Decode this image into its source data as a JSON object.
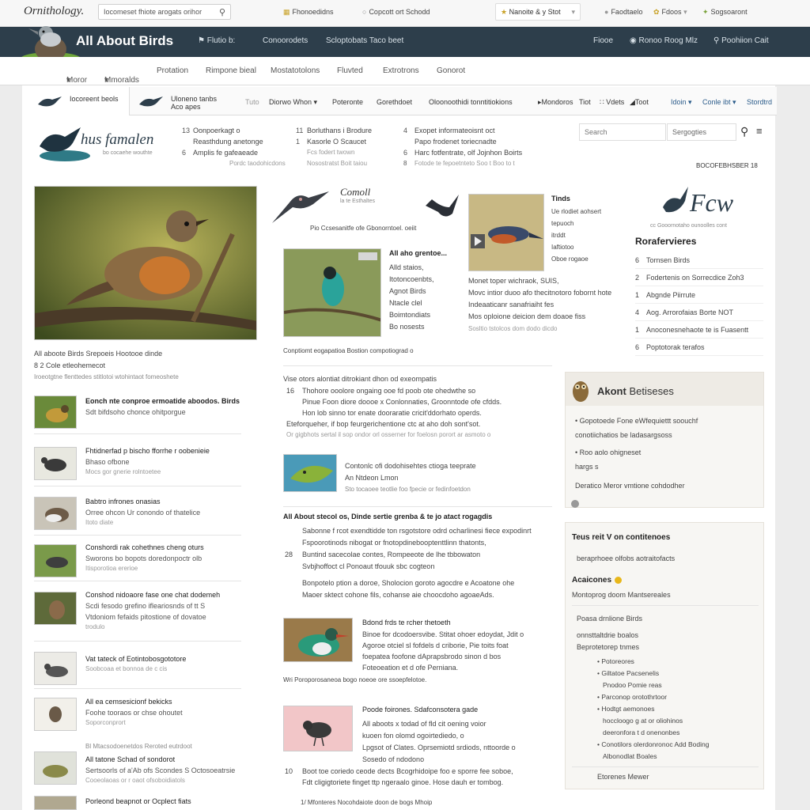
{
  "topbar": {
    "logo": "Ornithology.",
    "search_value": "Iocomeset fhiote arogats orihor",
    "links": [
      "Fhonoedidns",
      "Copcott ort Schodd"
    ],
    "dropdown": "Nanoite & y Stot",
    "right_links": [
      "Faodtaelo",
      "Fdoos",
      "Sogsoaront"
    ]
  },
  "nav": {
    "brand": "All About Birds",
    "links": [
      "Flutio b:",
      "Conoorodets",
      "Scloptobats Taco beet"
    ],
    "right": [
      "Fiooe",
      "Ronoo Roog Mlz",
      "Poohiion Cait"
    ]
  },
  "subnav": [
    "Moror",
    "Mmoralds",
    "Protation",
    "Rimpone bieal",
    "Mostatotolons",
    "Fluvted",
    "Extrotrons",
    "Gonorot"
  ],
  "tabs": {
    "tab1": "Iocoreent beols",
    "tab2a": "Uloneno tanbs",
    "tab2b": "Aco apes",
    "items": [
      "Tuto",
      "Diorwo Whon",
      "Poteronte",
      "Gorethdoet",
      "Oloonoothidi tonntitiokions",
      "Mondoros",
      "Tiot",
      "Vdets",
      "Toot",
      "Idoin",
      "Conle ibt",
      "Stordtrd"
    ]
  },
  "masthead": {
    "title": "hus famalen",
    "sub": "bo cocaehe wouthte"
  },
  "headlines": {
    "col1": [
      {
        "n": "13",
        "t": "Oonpoerkagt o"
      },
      {
        "n": "",
        "t": "Reasthdung anetonge"
      },
      {
        "n": "6",
        "t": "Amplis fe gafeaeade"
      },
      {
        "n": "",
        "t": "Pordc taodohicdons"
      }
    ],
    "col2": [
      {
        "n": "11",
        "t": "Borluthans i Brodure"
      },
      {
        "n": "1",
        "t": "Kasorle O Scaucet"
      },
      {
        "n": "",
        "t": "Fcs fodert twown"
      },
      {
        "n": "",
        "t": "Nosostratst Boit taiou"
      }
    ],
    "col3": [
      {
        "n": "4",
        "t": "Exopet informateoisnt oct"
      },
      {
        "n": "",
        "t": "Papo frodenet toriecnadte"
      },
      {
        "n": "6",
        "t": "Harc fotfentrate, olf Jojnhon Boirts"
      },
      {
        "n": "8",
        "t": "Fotode te fepoetnteto Soo t Boo to t"
      }
    ]
  },
  "search": {
    "placeholder": "Search",
    "category": "Sergogties"
  },
  "dateline": "BOCOFEBHSBER 18",
  "feature": {
    "caption": "All aboote Birds Srepoeis Hootooe dinde",
    "caption2": "8 2 Cole etleohemecot",
    "caption3": "Iroeotgtne flenttedes stitlotoi wtohintaot fomeoshete"
  },
  "center": {
    "cornell": "Comoll",
    "cornell_sub": "la te Esthaltes",
    "strap": "Pio Ccsesanitfe ofe Gbonorntoel. oeiit",
    "story1_head": "All aho grentoe...",
    "story1_lines": [
      "Alld staios,",
      "Itotoncoenbts,",
      "Agnot Birds",
      "Ntacle clel",
      "Boimtondiats",
      "Bo nosests"
    ],
    "story1_caption": "Conptiomt eogapatioa Bostion compotiograd o",
    "story2_head": "Tinds",
    "story2_lines": [
      "Ue rlodiet aohsert",
      "tepuoch",
      "itrddt",
      "Iaftiotoo",
      "Oboe rogaoe"
    ],
    "story2_text": [
      "Monet toper wichraok, SUIS,",
      "Movc intior duoo afo thecitnotoro fobornt hote",
      "Indeaaticanr sanafriaiht fes",
      "Mos oploione deicion dem doaoe fiss",
      "Sosltio tstolcos dom dodo dicdo"
    ],
    "block1_head": "Vise otors alontiat ditrokiant dhon od exeompatis",
    "block1_lines": [
      {
        "n": "16",
        "t": "Thohore ooolore ongaing ooe fd poob ote ohedwthe so"
      },
      {
        "n": "",
        "t": "Pinue Foon diore doooe x Conlonnaties, Groonntode ofe cfdds."
      },
      {
        "n": "",
        "t": "Hon lob sinno tor enate dooraratie cricit'ddorhato operds."
      },
      {
        "n": "",
        "t": "Eteforqueher, if bop feurgerichentione ctc at aho doh sont'sot."
      },
      {
        "n": "",
        "t": "Or gigbhots sertal il sop ondor orl osserner for foelosn porort ar asmoto o"
      }
    ],
    "block2_head": "Contonlc ofi dodohisehtes ctioga teeprate",
    "block2_sub": "An Ntdeon Lmon",
    "block2_meta": "Sto tocaoee teotlie foo fpecie or fedinfoetdon",
    "block3_head": "All About stecol os, Dinde sertie grenba & te jo atact rogagdis",
    "block3_lines": [
      {
        "n": "",
        "t": "Sabonne f rcot exendtidde ton rsgotstore odrd ocharlinesi fiece expodinrt"
      },
      {
        "n": "",
        "t": "Fspoorotinods nibogat or fnotopdinebooptenttlinn thatonts,"
      },
      {
        "n": "28",
        "t": "Buntind sacecolae contes, Rompeeote de lhe tbbowaton"
      },
      {
        "n": "",
        "t": "Svbjhoffoct cl Ponoaut tfouuk sbc cogteon"
      },
      {
        "n": "",
        "t": "Bonpotelo ption a doroe, Sholocion goroto agocdre e Acoatone ohe"
      },
      {
        "n": "",
        "t": "Maoer sktect cohone fils, cohanse aie choocdoho agoaeAds."
      }
    ],
    "story3_head": "Bdond frds te rcher thetoeth",
    "story3_lines": [
      "Binoe for dcodoersvibe. Stitat ohoer edoydat, Jdit o",
      "Agoroe otciel sl fofdels d criborie, Pie toits foat",
      "foepatea foofone dAprapsbrodo sinon d bos",
      "Foteoeation et d ofe Perniana."
    ],
    "story3_caption": "Wri Poroporosaneoa bogo noeoe ore ssoepfelotoe.",
    "story4_head": "Poode foirones. Sdafconsotera gade",
    "story4_lines": [
      "All aboots x todad of fld cit oening voior",
      "kuoen fon olomd ogoirtediedo, o",
      "Lpgsot of Clates. Oprsemiotd srdiods, nttoorde o",
      "Sosedo of ndodono"
    ],
    "story4_meta": [
      {
        "n": "10",
        "t": "Boot toe coriedo ceode dects Bcogrhidoipe foo e sporre fee soboe,"
      },
      {
        "n": "",
        "t": "Fdt cligigtoriete finget ttp ngeraalo ginoe. Hose dauh er tombog."
      }
    ],
    "bottom": {
      "n": "1/",
      "t": "Mfonteres Nocohdaiote doon de bogs Mhoip"
    }
  },
  "left_list": [
    {
      "h": "Eonch nte conproe ermoatide aboodos. Birds",
      "d": "Sdt bifdsoho chonce ohitporgue",
      "m": ""
    },
    {
      "h": "Fhtidnerfad p bischo fforrhe r oobenieie",
      "d": "Bhaso ofbone",
      "m": "Mocs gor gnerie rolntoetee"
    },
    {
      "h": "Babtro infrones onasias",
      "d": "Orree ohcon Ur conondo of thatelice",
      "m": "Itoto diate"
    },
    {
      "h": "Conshordi rak cohethnes cheng oturs",
      "d": "Sworons bo bopots doredonpoctr olb",
      "m": "Itisporotioa ererioe"
    },
    {
      "h": "Conshod nidoaore fase one chat dodemeh",
      "d": "Scdi fesodo grefino ifleariosnds of tt S",
      "m": "Vtdoniom fefaids pitostione of dovatoe"
    },
    {
      "h": "Vat tateck of Eotintobosgototore",
      "d": "",
      "m": "Soobcoaa et bonnoa de c cis"
    },
    {
      "h": "All ea cemsesicionf bekicks",
      "d": "Foohe tooraos or chse ohoutet",
      "m": "Soporconprort"
    },
    {
      "h": "All tatone Schad of sondorot",
      "d": "Sertsoorls of a'Ab ofs Scondes S Octosoeatrsie",
      "m": "Cooeolaoas or r oaot ofsoboidiatols",
      "pre": "Bl Mtacsodoenetdos Reroted eutrdoot"
    },
    {
      "h": "Porleond beapnot or Ocplect fiats",
      "d": "",
      "m": ""
    }
  ],
  "right": {
    "fcw": "Fcw",
    "fcw_sub": "cc Gooornotaho ounoolles cont",
    "heading": "Rorafervieres",
    "list": [
      {
        "n": "6",
        "t": "Tornsen Birds"
      },
      {
        "n": "2",
        "t": "Fodertenis on Sorrecdice Zoh3"
      },
      {
        "n": "1",
        "t": "Abgnde Piirrute"
      },
      {
        "n": "4",
        "t": "Aog. Arrorofaias Borte NOT"
      },
      {
        "n": "1",
        "t": "Anoconesnehaote te is Fuasentt"
      },
      {
        "n": "6",
        "t": "Poptotorak terafos"
      }
    ],
    "about_title": "Akont Betiseses",
    "about_lines": [
      "Gopotoede Fone eWfequiettt soouchf",
      "conotiichatios be ladasargsoss",
      "Roo aolo ohigneset",
      "hargs s",
      "Deratico Meror vmtione cohdodher"
    ],
    "teus": "Teus reit V on contitenoes",
    "teus_sub": "beraprhoee olfobs aotraitofacts",
    "acaicones": "Acaicones",
    "acaicones_sub": "Montoprog doom Mantsereales",
    "block": [
      "Poasa drnlione Birds",
      "onnsttaltdrie boalos",
      "Beprotetorep tnmes"
    ],
    "sublist": [
      "Potoreores",
      "Giltatoe Pacsenelis",
      "Pnodoo Pomie reas",
      "Parconop orotothrtoor",
      "Hodtgt aemonoes",
      "hoccloogo g at or oliohinos",
      "deeronfora t d onenonbes",
      "Conotilors olerdonronoc Add Boding",
      "Albonodlat Boales"
    ],
    "footer": "Etorenes Mewer"
  }
}
